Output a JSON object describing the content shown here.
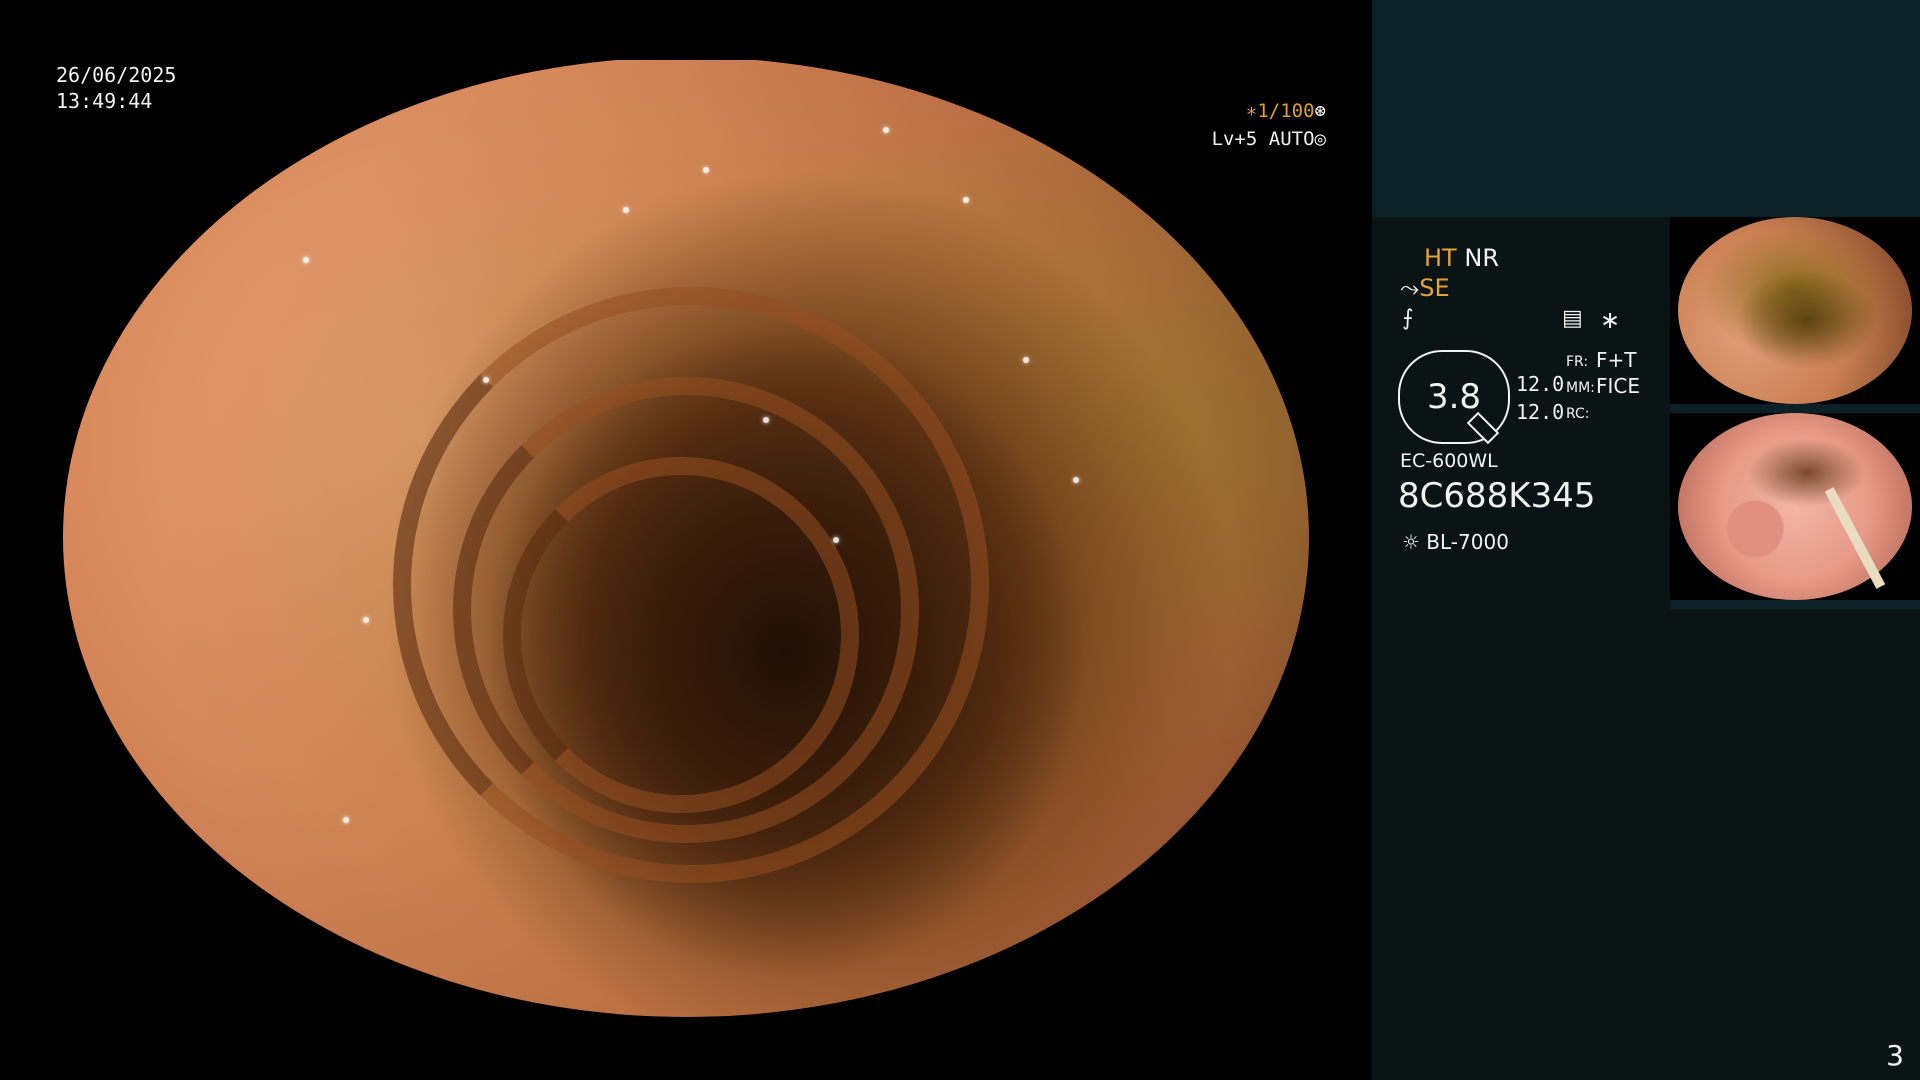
{
  "overlay": {
    "date": "26/06/2025",
    "time": "13:49:44",
    "shutter": "∗1/100",
    "shutter_icon": "aperture-icon",
    "light_level": "Lv+5 AUTO",
    "light_icon": "iris-icon"
  },
  "side_panel": {
    "ht": "HT",
    "nr": "NR",
    "se": "SE",
    "se_icon": "structure-enhance-icon",
    "enh_icon": "edge-icon",
    "menu_icon": "menu-icon",
    "star": "∗",
    "zoom": "3.8",
    "fr_label": "FR:",
    "fr_value": "F+T",
    "mm_label": "MM:",
    "mm_value": "FICE",
    "rc_label": "RC:",
    "val_1": "12.0",
    "val_2": "12.0",
    "scope_model": "EC-600WL",
    "scope_serial": "8C688K345",
    "light_source": "BL-7000",
    "light_source_icon": "lamp-icon"
  },
  "page_number": "3",
  "colors": {
    "accent": "#e8a234",
    "side_bg": "#0a1414",
    "side_top_bg": "#0b2126"
  }
}
